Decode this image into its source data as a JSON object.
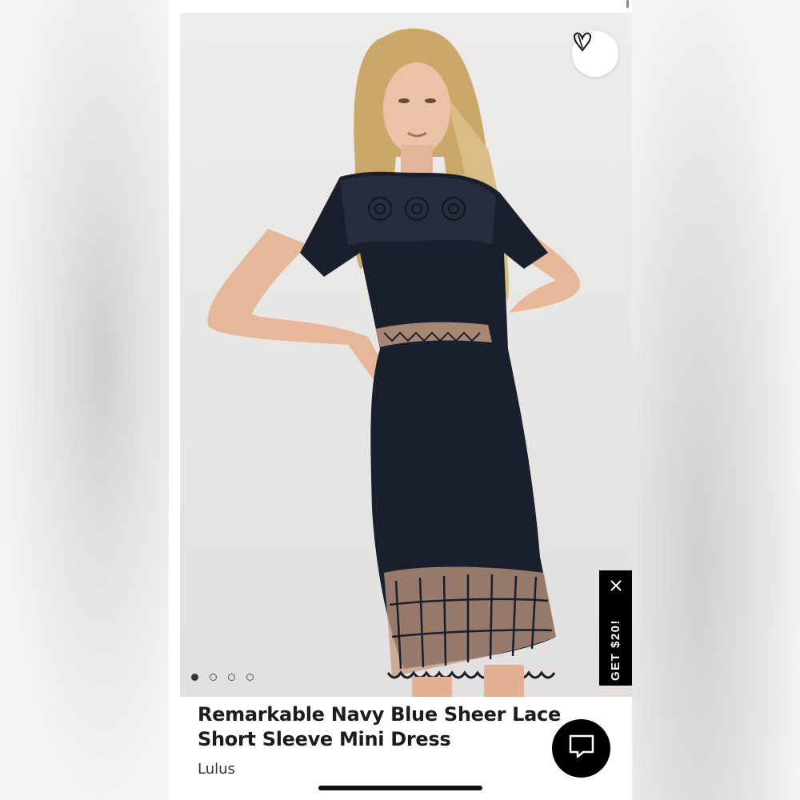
{
  "product": {
    "title": "Remarkable Navy Blue Sheer Lace Short Sleeve Mini Dress",
    "brand": "Lulus",
    "image_count": 4,
    "active_image_index": 0
  },
  "promo": {
    "label": "GET $20!",
    "close_icon": "close-icon"
  },
  "icons": {
    "favorite": "heart-icon",
    "chat": "chat-bubble-icon"
  },
  "colors": {
    "dress": "#1a1f2e",
    "promo_bg": "#000000",
    "photo_bg": "#e9e7e5"
  }
}
